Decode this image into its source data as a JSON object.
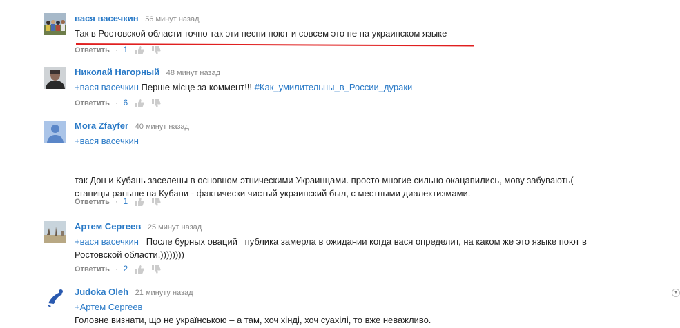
{
  "comments": [
    {
      "author": "вася васечкин",
      "time": "56 минут назад",
      "lines": [
        "Так в Ростовской области  точно так  эти песни поют и совсем это не на украинском языке"
      ],
      "reply": "Ответить",
      "likes": "1"
    },
    {
      "author": "Николай Нагорный",
      "time": "48 минут назад",
      "mention": "+вася васечкин",
      "text": " Перше місце за коммент!!! ",
      "hashtag": "#Как_умилительны_в_России_дураки",
      "reply": "Ответить",
      "likes": "6"
    },
    {
      "author": "Mora Zfayfer",
      "time": "40 минут назад",
      "mention": "+вася васечкин",
      "lines": [
        "так Дон и Кубань заселены в основном этническими Украинцами. просто многие сильно окацапились, мову забувають(",
        "станицы раньше на Кубани - фактически чистый украинский был, с местными диалектизмами."
      ],
      "reply": "Ответить",
      "likes": "1"
    },
    {
      "author": "Артем Сергеев",
      "time": "25 минут назад",
      "mention": "+вася васечкин",
      "text": "   После бурных оваций   публика замерла в ожидании когда вася определит, на каком же это языке поют в",
      "text2": "Ростовской области.))))))))",
      "reply": "Ответить",
      "likes": "2"
    },
    {
      "author": "Judoka Oleh",
      "time": "21 минуту назад",
      "mention": "+Артем Сергеев",
      "text": "Головне визнати, що не українською – а там, хоч хінді, хоч суахілі, то вже неважливо."
    }
  ],
  "colors": {
    "link": "#2a7ac7",
    "underline": "#e02020"
  },
  "icons": {
    "like": "thumb-up-icon",
    "dislike": "thumb-down-icon"
  }
}
